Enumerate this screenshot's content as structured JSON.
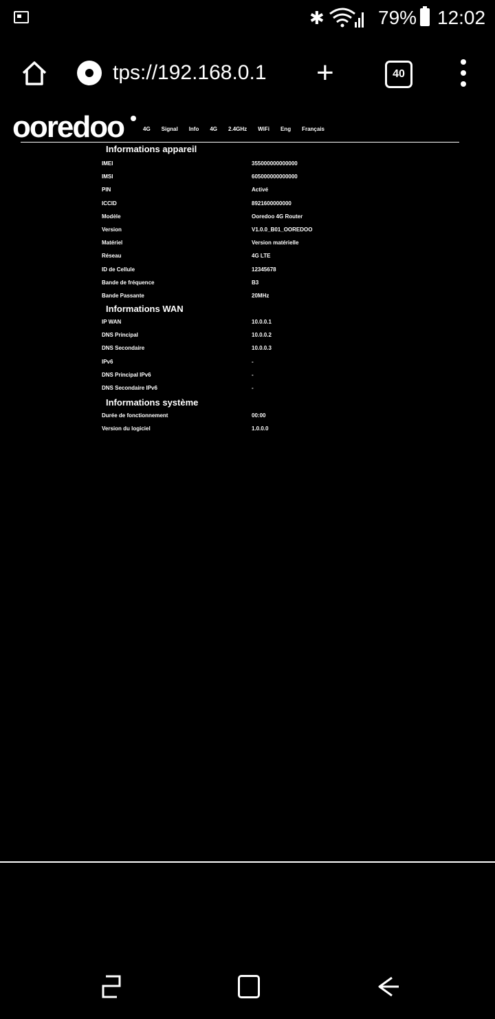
{
  "status_bar": {
    "notification_icon": "image-icon",
    "bluetooth_icon": "bluetooth-icon",
    "wifi_icon": "wifi-signal-icon",
    "battery": "79%",
    "time": "12:02"
  },
  "browser": {
    "url": "tps://192.168.0.1",
    "tab_count": "40",
    "new_tab_symbol": "+"
  },
  "page": {
    "logo": "ooredoo",
    "nav_items": [
      "4G",
      "Signal",
      "Info",
      "4G",
      "2.4GHz",
      "WiFi",
      "Eng",
      "Français"
    ],
    "sections": [
      {
        "title": "Informations appareil",
        "rows": [
          {
            "label": "IMEI",
            "value": "355000000000000"
          },
          {
            "label": "IMSI",
            "value": "605000000000000"
          },
          {
            "label": "PIN",
            "value": "Activé"
          },
          {
            "label": "ICCID",
            "value": "8921600000000"
          },
          {
            "label": "Modèle",
            "value": "Ooredoo 4G Router"
          },
          {
            "label": "Version",
            "value": "V1.0.0_B01_OOREDOO"
          },
          {
            "label": "Matériel",
            "value": "Version matérielle"
          },
          {
            "label": "Réseau",
            "value": "4G LTE"
          },
          {
            "label": "ID de Cellule",
            "value": "12345678"
          },
          {
            "label": "Bande de fréquence",
            "value": "B3"
          },
          {
            "label": "Bande Passante",
            "value": "20MHz"
          }
        ]
      },
      {
        "title": "Informations WAN",
        "rows": [
          {
            "label": "IP WAN",
            "value": "10.0.0.1"
          },
          {
            "label": "DNS Principal",
            "value": "10.0.0.2"
          },
          {
            "label": "DNS Secondaire",
            "value": "10.0.0.3"
          },
          {
            "label": "IPv6",
            "value": "-"
          },
          {
            "label": "DNS Principal IPv6",
            "value": "-"
          },
          {
            "label": "DNS Secondaire IPv6",
            "value": "-"
          }
        ]
      },
      {
        "title": "Informations système",
        "rows": [
          {
            "label": "Durée de fonctionnement",
            "value": "00:00"
          },
          {
            "label": "Version du logiciel",
            "value": "1.0.0.0"
          }
        ]
      }
    ]
  },
  "nav_bar": {
    "recents_icon": "recents-icon",
    "home_icon": "home-square-icon",
    "back_icon": "back-arrow-icon"
  }
}
